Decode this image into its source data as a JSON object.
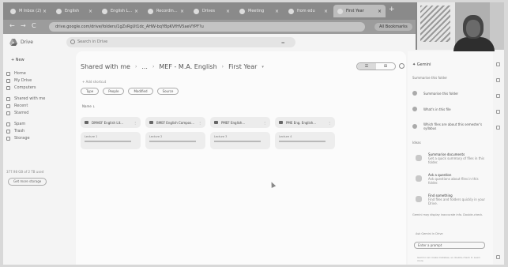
{
  "browser": {
    "tabs": [
      {
        "label": "M Inbox (2)",
        "active": false
      },
      {
        "label": "English",
        "active": false
      },
      {
        "label": "English L...",
        "active": false
      },
      {
        "label": "Recordin...",
        "active": false
      },
      {
        "label": "Drives",
        "active": false
      },
      {
        "label": "Meeting",
        "active": false
      },
      {
        "label": "from edu",
        "active": false
      },
      {
        "label": "First Year",
        "active": true
      }
    ],
    "new_tab": "+",
    "address": "drive.google.com/drive/folders/1gZvRgUt1dc_AHW-bqYBpKVfHV5aeVYPF?u",
    "gdocs_label": "All Bookmarks",
    "nav": {
      "back": "←",
      "forward": "→",
      "reload": "C"
    }
  },
  "drive": {
    "title": "Drive",
    "search_placeholder": "Search in Drive",
    "filter_icon": "⚌",
    "new_label": "+ New",
    "nav": [
      {
        "label": "Home",
        "icon": "home-icon"
      },
      {
        "label": "My Drive",
        "icon": "drive-icon"
      },
      {
        "label": "Computers",
        "icon": "computer-icon"
      },
      {
        "label": "Shared with me",
        "icon": "shared-icon"
      },
      {
        "label": "Recent",
        "icon": "clock-icon"
      },
      {
        "label": "Starred",
        "icon": "star-icon"
      },
      {
        "label": "Spam",
        "icon": "spam-icon"
      },
      {
        "label": "Trash",
        "icon": "trash-icon"
      },
      {
        "label": "Storage",
        "icon": "cloud-icon"
      }
    ],
    "storage_text": "377.98 GB of 2 TB used",
    "storage_button": "Get more storage"
  },
  "main": {
    "breadcrumb": [
      "Shared with me",
      "...",
      "MEF - M.A. English",
      "First Year"
    ],
    "add_shortcut": "+ Add shortcut",
    "chips": [
      "Type",
      "People",
      "Modified",
      "Source"
    ],
    "sort_label": "Name ↓",
    "view_list": "☰",
    "view_grid": "⊞",
    "folders": [
      {
        "name": "DMHEF English Lit..."
      },
      {
        "name": "BMEF English Compos..."
      },
      {
        "name": "PMEF English..."
      },
      {
        "name": "PME Eng. English..."
      }
    ],
    "files": [
      {
        "name": "Lecture 1"
      },
      {
        "name": "Lecture 2"
      },
      {
        "name": "Lecture 3"
      },
      {
        "name": "Lecture 4"
      }
    ]
  },
  "gemini": {
    "title": "✦ Gemini",
    "subtitle": "Summarise this folder",
    "suggestions": [
      "Summarise this folder",
      "What's in this file",
      "Which files are about this semester's syllabus"
    ],
    "section_label": "Ideas",
    "cards": [
      {
        "title": "Summarise documents",
        "desc": "Get a quick summary of files in this folder."
      },
      {
        "title": "Ask a question",
        "desc": "Ask questions about files in this folder."
      },
      {
        "title": "Find something",
        "desc": "Find files and folders quickly in your Drive."
      }
    ],
    "footer": "Gemini may display inaccurate info. Double-check.",
    "hint": "Ask Gemini in Drive",
    "input_placeholder": "Enter a prompt",
    "disclaimer": "Gemini can make mistakes, so double-check it. Learn more"
  }
}
